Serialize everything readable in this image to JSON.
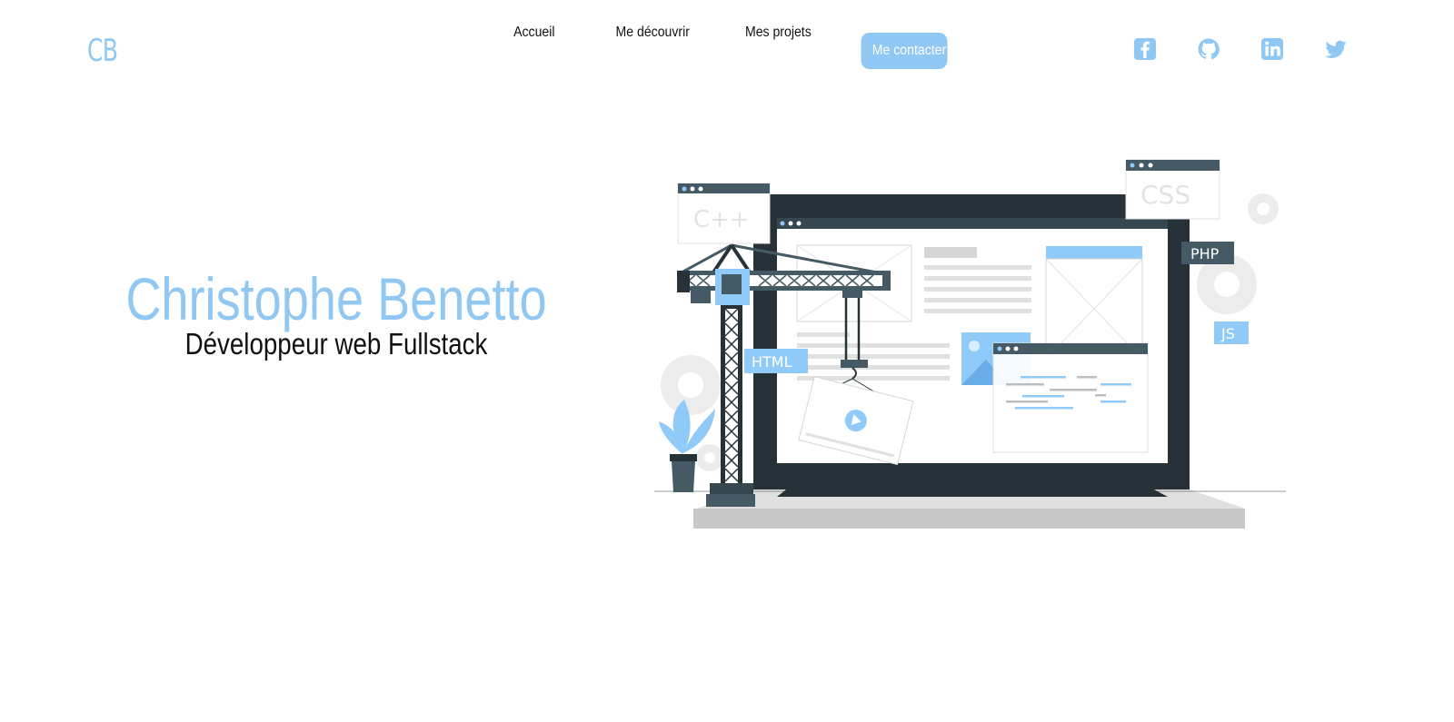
{
  "brand": {
    "logo": "CB",
    "accent": "#90c8f3"
  },
  "nav": {
    "links": [
      {
        "label": "Accueil"
      },
      {
        "label": "Me découvrir"
      },
      {
        "label": "Mes projets"
      },
      {
        "label": "Me contacter"
      }
    ]
  },
  "socials": [
    {
      "icon": "facebook-icon"
    },
    {
      "icon": "github-icon"
    },
    {
      "icon": "linkedin-icon"
    },
    {
      "icon": "twitter-icon"
    }
  ],
  "hero": {
    "name": "Christophe Benetto",
    "subtitle": "Développeur web Fullstack"
  },
  "illustration": {
    "tags": {
      "cpp": "C++",
      "css": "CSS",
      "php": "PHP",
      "js": "JS",
      "html": "HTML"
    },
    "colors": {
      "dark": "#263238",
      "slate": "#455a64",
      "light_gray": "#e0e0e0",
      "blue": "#90caf9"
    }
  }
}
